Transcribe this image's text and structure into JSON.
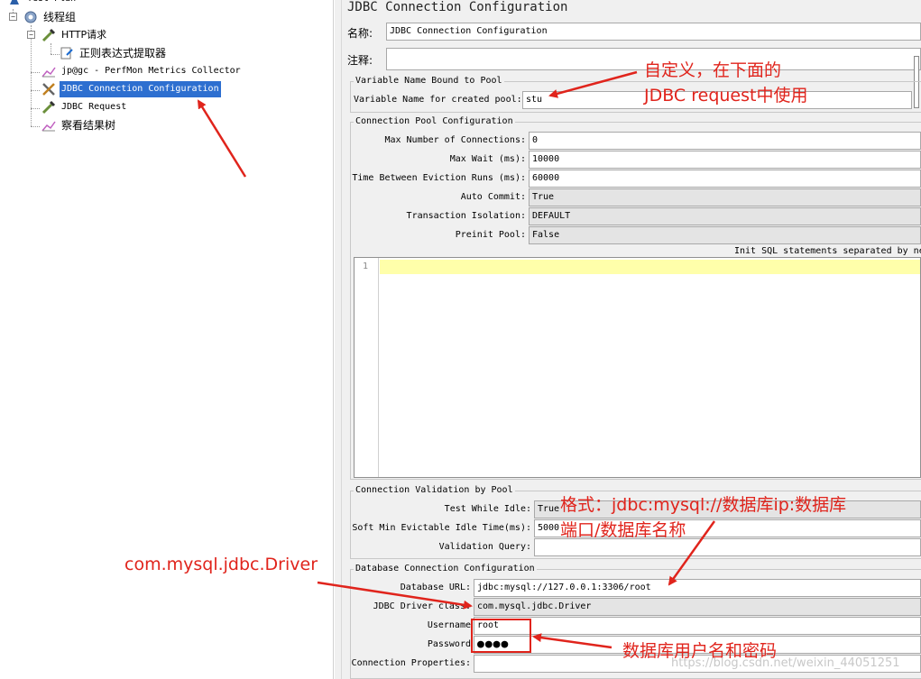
{
  "tree": {
    "items": [
      {
        "label": "Test Plan",
        "icon": "test-plan-icon"
      },
      {
        "label": "线程组",
        "icon": "gear-icon"
      },
      {
        "label": "HTTP请求",
        "icon": "pipette-icon"
      },
      {
        "label": "正则表达式提取器",
        "icon": "extractor-icon"
      },
      {
        "label": "jp@gc - PerfMon Metrics Collector",
        "icon": "graph-icon"
      },
      {
        "label": "JDBC Connection Configuration",
        "icon": "wrench-icon"
      },
      {
        "label": "JDBC Request",
        "icon": "pipette-icon"
      },
      {
        "label": "察看结果树",
        "icon": "graph-icon"
      }
    ],
    "selected": "JDBC Connection Configuration"
  },
  "panel": {
    "title": "JDBC Connection Configuration",
    "name_label": "名称:",
    "name_value": "JDBC Connection Configuration",
    "comment_label": "注释:",
    "comment_value": ""
  },
  "var_group": {
    "title": "Variable Name Bound to Pool",
    "label": "Variable Name for created pool:",
    "value": "stu"
  },
  "pool_group": {
    "title": "Connection Pool Configuration",
    "max_conn_label": "Max Number of Connections:",
    "max_conn_value": "0",
    "max_wait_label": "Max Wait (ms):",
    "max_wait_value": "10000",
    "eviction_label": "Time Between Eviction Runs (ms):",
    "eviction_value": "60000",
    "autocommit_label": "Auto Commit:",
    "autocommit_value": "True",
    "isolation_label": "Transaction Isolation:",
    "isolation_value": "DEFAULT",
    "preinit_label": "Preinit Pool:",
    "preinit_value": "False",
    "init_sql_label": "Init SQL statements separated by ne",
    "line_number": "1"
  },
  "validation_group": {
    "title": "Connection Validation by Pool",
    "test_idle_label": "Test While Idle:",
    "test_idle_value": "True",
    "soft_min_label": "Soft Min Evictable Idle Time(ms):",
    "soft_min_value": "5000",
    "query_label": "Validation Query:",
    "query_value": ""
  },
  "db_group": {
    "title": "Database Connection Configuration",
    "url_label": "Database URL:",
    "url_value": "jdbc:mysql://127.0.0.1:3306/root",
    "driver_label": "JDBC Driver class:",
    "driver_value": "com.mysql.jdbc.Driver",
    "user_label": "Username",
    "user_value": "root",
    "pass_label": "Password",
    "pass_value": "●●●●",
    "props_label": "Connection Properties:",
    "props_value": ""
  },
  "annotations": {
    "var_note_line1": "自定义，在下面的",
    "var_note_line2": "JDBC request中使用",
    "url_note_line1": "格式：jdbc:mysql://数据库ip:数据库",
    "url_note_line2": "端口/数据库名称",
    "driver_note": "com.mysql.jdbc.Driver",
    "cred_note": "数据库用户名和密码",
    "color": "#e0241c"
  },
  "watermark": "https://blog.csdn.net/weixin_44051251"
}
